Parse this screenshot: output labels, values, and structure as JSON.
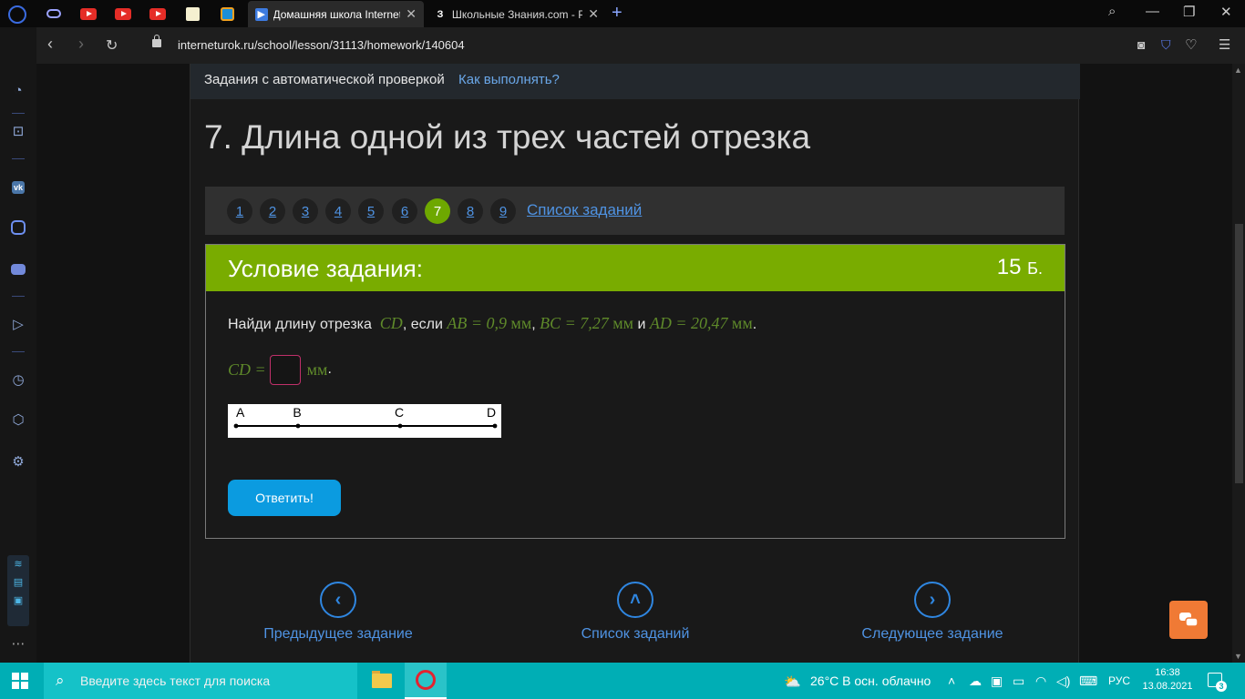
{
  "browser": {
    "tabs": [
      {
        "title": "Домашняя школа Interneturok",
        "favicon": "play-icon",
        "active": true
      },
      {
        "title": "Школьные Знания.com - Р",
        "favicon": "z-icon",
        "favicon_text": "З",
        "active": false
      }
    ],
    "new_tab": "+",
    "url": "interneturok.ru/school/lesson/31113/homework/140604"
  },
  "page": {
    "task_strip": {
      "label": "Задания с автоматической проверкой",
      "help_link": "Как выполнять?"
    },
    "lesson_title": "7. Длина одной из трех частей отрезка",
    "pager": {
      "pages": [
        "1",
        "2",
        "3",
        "4",
        "5",
        "6",
        "7",
        "8",
        "9"
      ],
      "current": "7",
      "list_link": "Список заданий"
    },
    "condition": {
      "title": "Условие задания:",
      "points": "15",
      "points_unit": "Б.",
      "question": {
        "prefix": "Найди длину отрезка",
        "cd": "CD",
        "if": ", если",
        "ab": "AB = 0,9",
        "unit": "мм",
        "bc": "BC = 7,27",
        "and": "и",
        "ad": "AD = 20,47",
        "end": "."
      },
      "answer": {
        "lhs": "CD =",
        "value": "",
        "unit": "мм",
        "end": "."
      },
      "figure": {
        "points": [
          {
            "label": "A"
          },
          {
            "label": "B"
          },
          {
            "label": "C"
          },
          {
            "label": "D"
          }
        ]
      },
      "submit": "Ответить!"
    },
    "nav": {
      "prev": "Предыдущее задание",
      "list": "Список заданий",
      "next": "Следующее задание"
    }
  },
  "taskbar": {
    "search_placeholder": "Введите здесь текст для поиска",
    "weather": "26°C  В осн. облачно",
    "language": "РУС",
    "time": "16:38",
    "date": "13.08.2021",
    "notifications": "3"
  }
}
